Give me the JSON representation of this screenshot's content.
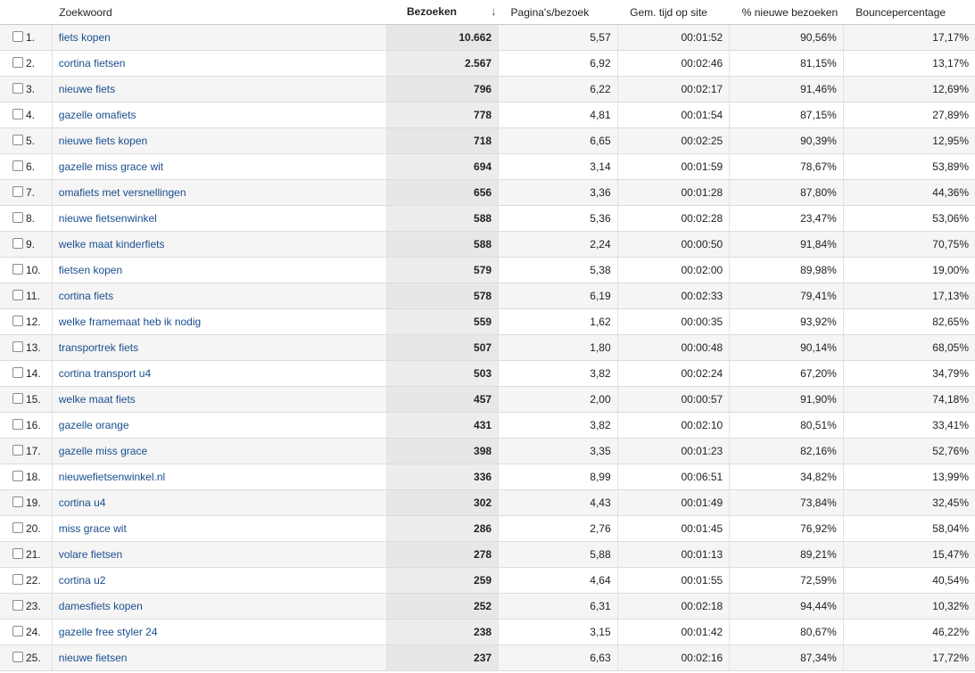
{
  "headers": {
    "keyword": "Zoekwoord",
    "visits": "Bezoeken",
    "pages_per_visit": "Pagina's/bezoek",
    "avg_time": "Gem. tijd op site",
    "new_visits": "% nieuwe bezoeken",
    "bounce": "Bouncepercentage"
  },
  "rows": [
    {
      "n": "1.",
      "keyword": "fiets kopen",
      "visits": "10.662",
      "ppv": "5,57",
      "time": "00:01:52",
      "new": "90,56%",
      "bounce": "17,17%"
    },
    {
      "n": "2.",
      "keyword": "cortina fietsen",
      "visits": "2.567",
      "ppv": "6,92",
      "time": "00:02:46",
      "new": "81,15%",
      "bounce": "13,17%"
    },
    {
      "n": "3.",
      "keyword": "nieuwe fiets",
      "visits": "796",
      "ppv": "6,22",
      "time": "00:02:17",
      "new": "91,46%",
      "bounce": "12,69%"
    },
    {
      "n": "4.",
      "keyword": "gazelle omafiets",
      "visits": "778",
      "ppv": "4,81",
      "time": "00:01:54",
      "new": "87,15%",
      "bounce": "27,89%"
    },
    {
      "n": "5.",
      "keyword": "nieuwe fiets kopen",
      "visits": "718",
      "ppv": "6,65",
      "time": "00:02:25",
      "new": "90,39%",
      "bounce": "12,95%"
    },
    {
      "n": "6.",
      "keyword": "gazelle miss grace wit",
      "visits": "694",
      "ppv": "3,14",
      "time": "00:01:59",
      "new": "78,67%",
      "bounce": "53,89%"
    },
    {
      "n": "7.",
      "keyword": "omafiets met versnellingen",
      "visits": "656",
      "ppv": "3,36",
      "time": "00:01:28",
      "new": "87,80%",
      "bounce": "44,36%"
    },
    {
      "n": "8.",
      "keyword": "nieuwe fietsenwinkel",
      "visits": "588",
      "ppv": "5,36",
      "time": "00:02:28",
      "new": "23,47%",
      "bounce": "53,06%"
    },
    {
      "n": "9.",
      "keyword": "welke maat kinderfiets",
      "visits": "588",
      "ppv": "2,24",
      "time": "00:00:50",
      "new": "91,84%",
      "bounce": "70,75%"
    },
    {
      "n": "10.",
      "keyword": "fietsen kopen",
      "visits": "579",
      "ppv": "5,38",
      "time": "00:02:00",
      "new": "89,98%",
      "bounce": "19,00%"
    },
    {
      "n": "11.",
      "keyword": "cortina fiets",
      "visits": "578",
      "ppv": "6,19",
      "time": "00:02:33",
      "new": "79,41%",
      "bounce": "17,13%"
    },
    {
      "n": "12.",
      "keyword": "welke framemaat heb ik nodig",
      "visits": "559",
      "ppv": "1,62",
      "time": "00:00:35",
      "new": "93,92%",
      "bounce": "82,65%"
    },
    {
      "n": "13.",
      "keyword": "transportrek fiets",
      "visits": "507",
      "ppv": "1,80",
      "time": "00:00:48",
      "new": "90,14%",
      "bounce": "68,05%"
    },
    {
      "n": "14.",
      "keyword": "cortina transport u4",
      "visits": "503",
      "ppv": "3,82",
      "time": "00:02:24",
      "new": "67,20%",
      "bounce": "34,79%"
    },
    {
      "n": "15.",
      "keyword": "welke maat fiets",
      "visits": "457",
      "ppv": "2,00",
      "time": "00:00:57",
      "new": "91,90%",
      "bounce": "74,18%"
    },
    {
      "n": "16.",
      "keyword": "gazelle orange",
      "visits": "431",
      "ppv": "3,82",
      "time": "00:02:10",
      "new": "80,51%",
      "bounce": "33,41%"
    },
    {
      "n": "17.",
      "keyword": "gazelle miss grace",
      "visits": "398",
      "ppv": "3,35",
      "time": "00:01:23",
      "new": "82,16%",
      "bounce": "52,76%"
    },
    {
      "n": "18.",
      "keyword": "nieuwefietsenwinkel.nl",
      "visits": "336",
      "ppv": "8,99",
      "time": "00:06:51",
      "new": "34,82%",
      "bounce": "13,99%"
    },
    {
      "n": "19.",
      "keyword": "cortina u4",
      "visits": "302",
      "ppv": "4,43",
      "time": "00:01:49",
      "new": "73,84%",
      "bounce": "32,45%"
    },
    {
      "n": "20.",
      "keyword": "miss grace wit",
      "visits": "286",
      "ppv": "2,76",
      "time": "00:01:45",
      "new": "76,92%",
      "bounce": "58,04%"
    },
    {
      "n": "21.",
      "keyword": "volare fietsen",
      "visits": "278",
      "ppv": "5,88",
      "time": "00:01:13",
      "new": "89,21%",
      "bounce": "15,47%"
    },
    {
      "n": "22.",
      "keyword": "cortina u2",
      "visits": "259",
      "ppv": "4,64",
      "time": "00:01:55",
      "new": "72,59%",
      "bounce": "40,54%"
    },
    {
      "n": "23.",
      "keyword": "damesfiets kopen",
      "visits": "252",
      "ppv": "6,31",
      "time": "00:02:18",
      "new": "94,44%",
      "bounce": "10,32%"
    },
    {
      "n": "24.",
      "keyword": "gazelle free styler 24",
      "visits": "238",
      "ppv": "3,15",
      "time": "00:01:42",
      "new": "80,67%",
      "bounce": "46,22%"
    },
    {
      "n": "25.",
      "keyword": "nieuwe fietsen",
      "visits": "237",
      "ppv": "6,63",
      "time": "00:02:16",
      "new": "87,34%",
      "bounce": "17,72%"
    }
  ]
}
